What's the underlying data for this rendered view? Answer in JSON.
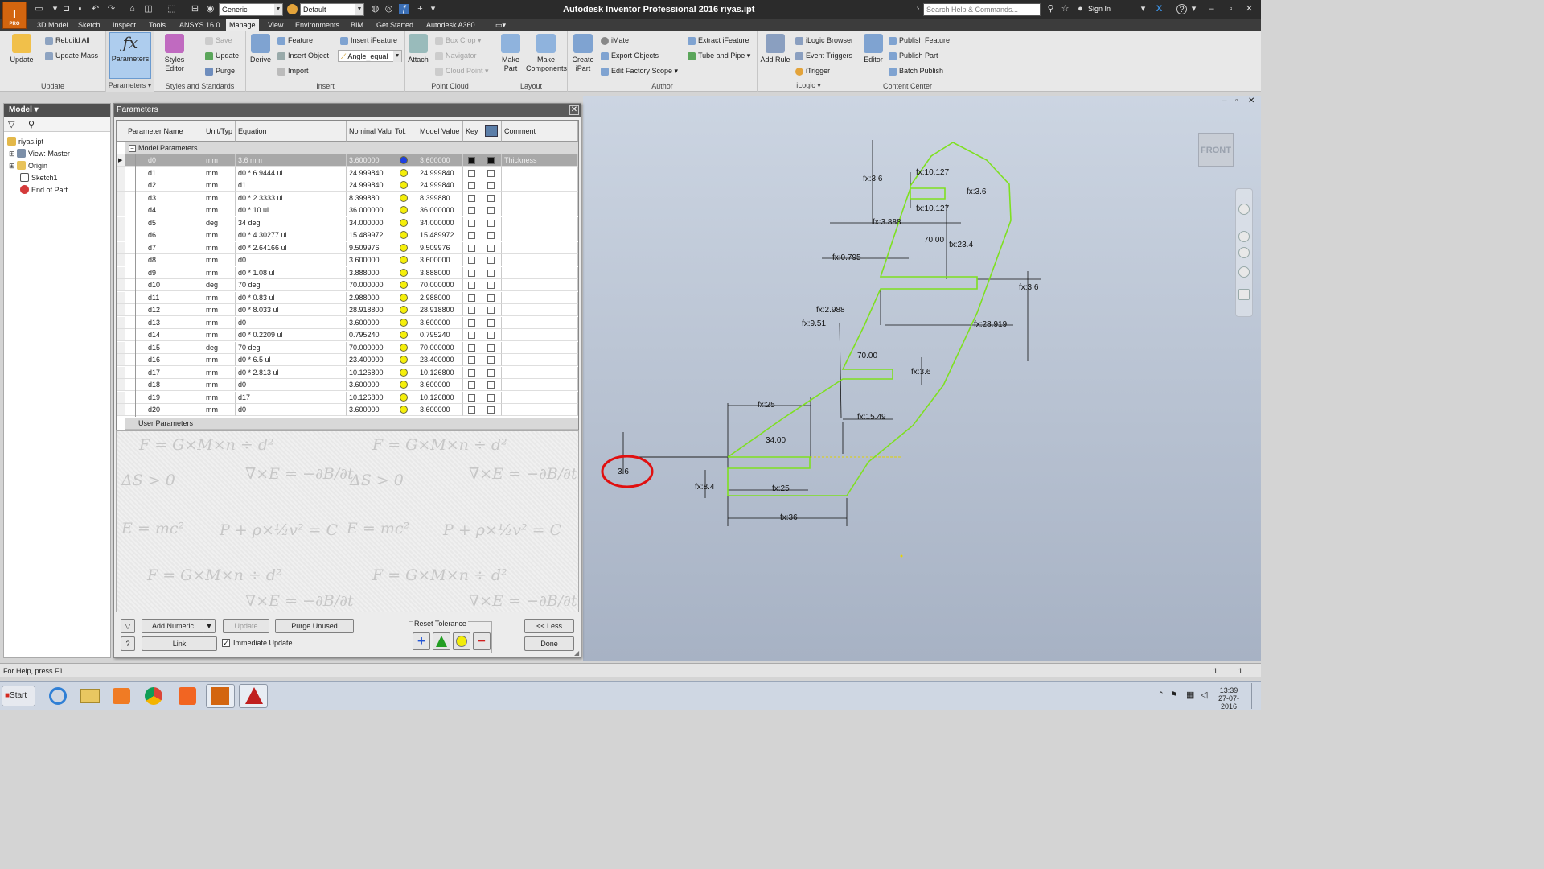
{
  "app": {
    "logo_letter": "I",
    "logo_sub": "PRO",
    "title": "Autodesk Inventor Professional 2016   riyas.ipt",
    "search_placeholder": "Search Help & Commands...",
    "sign_in": "Sign In"
  },
  "quick_access": {
    "material": "Generic",
    "appearance": "Default"
  },
  "tabs": [
    "3D Model",
    "Sketch",
    "Inspect",
    "Tools",
    "ANSYS 16.0",
    "Manage",
    "View",
    "Environments",
    "BIM",
    "Get Started",
    "Autodesk A360"
  ],
  "active_tab": "Manage",
  "ribbon": {
    "update": {
      "label": "Update",
      "panel": "Update",
      "rebuild": "Rebuild All",
      "update_mass": "Update Mass"
    },
    "parameters": {
      "label": "Parameters",
      "panel": "Parameters"
    },
    "styles": {
      "label": "Styles Editor",
      "save": "Save",
      "update": "Update",
      "purge": "Purge",
      "panel": "Styles and Standards"
    },
    "insert": {
      "derive": "Derive",
      "feature": "Feature",
      "insert_object": "Insert Object",
      "import": "Import",
      "insert_ifeature": "Insert iFeature",
      "angle": "Angle_equal",
      "panel": "Insert"
    },
    "pointcloud": {
      "attach": "Attach",
      "box_crop": "Box Crop",
      "navigator": "Navigator",
      "cloud_point": "Cloud Point",
      "panel": "Point Cloud"
    },
    "layout": {
      "make_part": "Make Part",
      "make_components": "Make Components",
      "panel": "Layout"
    },
    "author": {
      "create_ipart": "Create iPart",
      "imate": "iMate",
      "export_objects": "Export Objects",
      "edit_factory": "Edit Factory Scope",
      "extract": "Extract iFeature",
      "tube_pipe": "Tube and Pipe",
      "panel": "Author"
    },
    "ilogic": {
      "add_rule": "Add Rule",
      "browser": "iLogic Browser",
      "events": "Event Triggers",
      "itrigger": "iTrigger",
      "panel": "iLogic"
    },
    "content": {
      "editor": "Editor",
      "publish_feature": "Publish Feature",
      "publish_part": "Publish Part",
      "batch": "Batch Publish",
      "panel": "Content Center"
    }
  },
  "browser": {
    "title": "Model",
    "items": [
      "riyas.ipt",
      "View: Master",
      "Origin",
      "Sketch1",
      "End of Part"
    ]
  },
  "dialog": {
    "title": "Parameters",
    "columns": [
      "Parameter Name",
      "Unit/Typ",
      "Equation",
      "Nominal Valu",
      "Tol.",
      "Model Value",
      "Key",
      "",
      "Comment"
    ],
    "group_model": "Model Parameters",
    "group_user": "User Parameters",
    "rows": [
      {
        "name": "d0",
        "unit": "mm",
        "eq": "3.6 mm",
        "nom": "3.600000",
        "model": "3.600000",
        "tol": "blue",
        "comment": "Thickness"
      },
      {
        "name": "d1",
        "unit": "mm",
        "eq": "d0 * 6.9444 ul",
        "nom": "24.999840",
        "model": "24.999840",
        "tol": "yellow",
        "comment": ""
      },
      {
        "name": "d2",
        "unit": "mm",
        "eq": "d1",
        "nom": "24.999840",
        "model": "24.999840",
        "tol": "yellow",
        "comment": ""
      },
      {
        "name": "d3",
        "unit": "mm",
        "eq": "d0 * 2.3333 ul",
        "nom": "8.399880",
        "model": "8.399880",
        "tol": "yellow",
        "comment": ""
      },
      {
        "name": "d4",
        "unit": "mm",
        "eq": "d0 * 10 ul",
        "nom": "36.000000",
        "model": "36.000000",
        "tol": "yellow",
        "comment": ""
      },
      {
        "name": "d5",
        "unit": "deg",
        "eq": "34 deg",
        "nom": "34.000000",
        "model": "34.000000",
        "tol": "yellow",
        "comment": ""
      },
      {
        "name": "d6",
        "unit": "mm",
        "eq": "d0 * 4.30277 ul",
        "nom": "15.489972",
        "model": "15.489972",
        "tol": "yellow",
        "comment": ""
      },
      {
        "name": "d7",
        "unit": "mm",
        "eq": "d0 * 2.64166 ul",
        "nom": "9.509976",
        "model": "9.509976",
        "tol": "yellow",
        "comment": ""
      },
      {
        "name": "d8",
        "unit": "mm",
        "eq": "d0",
        "nom": "3.600000",
        "model": "3.600000",
        "tol": "yellow",
        "comment": ""
      },
      {
        "name": "d9",
        "unit": "mm",
        "eq": "d0 * 1.08 ul",
        "nom": "3.888000",
        "model": "3.888000",
        "tol": "yellow",
        "comment": ""
      },
      {
        "name": "d10",
        "unit": "deg",
        "eq": "70 deg",
        "nom": "70.000000",
        "model": "70.000000",
        "tol": "yellow",
        "comment": ""
      },
      {
        "name": "d11",
        "unit": "mm",
        "eq": "d0 * 0.83 ul",
        "nom": "2.988000",
        "model": "2.988000",
        "tol": "yellow",
        "comment": ""
      },
      {
        "name": "d12",
        "unit": "mm",
        "eq": "d0 * 8.033 ul",
        "nom": "28.918800",
        "model": "28.918800",
        "tol": "yellow",
        "comment": ""
      },
      {
        "name": "d13",
        "unit": "mm",
        "eq": "d0",
        "nom": "3.600000",
        "model": "3.600000",
        "tol": "yellow",
        "comment": ""
      },
      {
        "name": "d14",
        "unit": "mm",
        "eq": "d0 * 0.2209 ul",
        "nom": "0.795240",
        "model": "0.795240",
        "tol": "yellow",
        "comment": ""
      },
      {
        "name": "d15",
        "unit": "deg",
        "eq": "70 deg",
        "nom": "70.000000",
        "model": "70.000000",
        "tol": "yellow",
        "comment": ""
      },
      {
        "name": "d16",
        "unit": "mm",
        "eq": "d0 * 6.5 ul",
        "nom": "23.400000",
        "model": "23.400000",
        "tol": "yellow",
        "comment": ""
      },
      {
        "name": "d17",
        "unit": "mm",
        "eq": "d0 * 2.813 ul",
        "nom": "10.126800",
        "model": "10.126800",
        "tol": "yellow",
        "comment": ""
      },
      {
        "name": "d18",
        "unit": "mm",
        "eq": "d0",
        "nom": "3.600000",
        "model": "3.600000",
        "tol": "yellow",
        "comment": ""
      },
      {
        "name": "d19",
        "unit": "mm",
        "eq": "d17",
        "nom": "10.126800",
        "model": "10.126800",
        "tol": "yellow",
        "comment": ""
      },
      {
        "name": "d20",
        "unit": "mm",
        "eq": "d0",
        "nom": "3.600000",
        "model": "3.600000",
        "tol": "yellow",
        "comment": ""
      }
    ],
    "buttons": {
      "add_numeric": "Add Numeric",
      "update": "Update",
      "purge": "Purge Unused",
      "less": "<< Less",
      "link": "Link",
      "immediate": "Immediate Update",
      "reset_tol": "Reset Tolerance",
      "done": "Done"
    }
  },
  "viewcube": "FRONT",
  "dims": [
    {
      "t": "fx:10.127"
    },
    {
      "t": "fx:3.6"
    },
    {
      "t": "fx:3.6"
    },
    {
      "t": "fx:10.127"
    },
    {
      "t": "fx:3.888"
    },
    {
      "t": "70.00"
    },
    {
      "t": "fx:23.4"
    },
    {
      "t": "fx:0.795"
    },
    {
      "t": "fx:3.6"
    },
    {
      "t": "fx:2.988"
    },
    {
      "t": "fx:9.51"
    },
    {
      "t": "fx:28.919"
    },
    {
      "t": "70.00"
    },
    {
      "t": "fx:3.6"
    },
    {
      "t": "fx:25"
    },
    {
      "t": "fx:15.49"
    },
    {
      "t": "34.00"
    },
    {
      "t": "3.6"
    },
    {
      "t": "fx:8.4"
    },
    {
      "t": "fx:25"
    },
    {
      "t": "fx:36"
    }
  ],
  "status": {
    "help": "For Help, press F1",
    "count1": "1",
    "count2": "1"
  },
  "taskbar": {
    "start": "Start",
    "time": "13:39",
    "date": "27-07-2016"
  }
}
